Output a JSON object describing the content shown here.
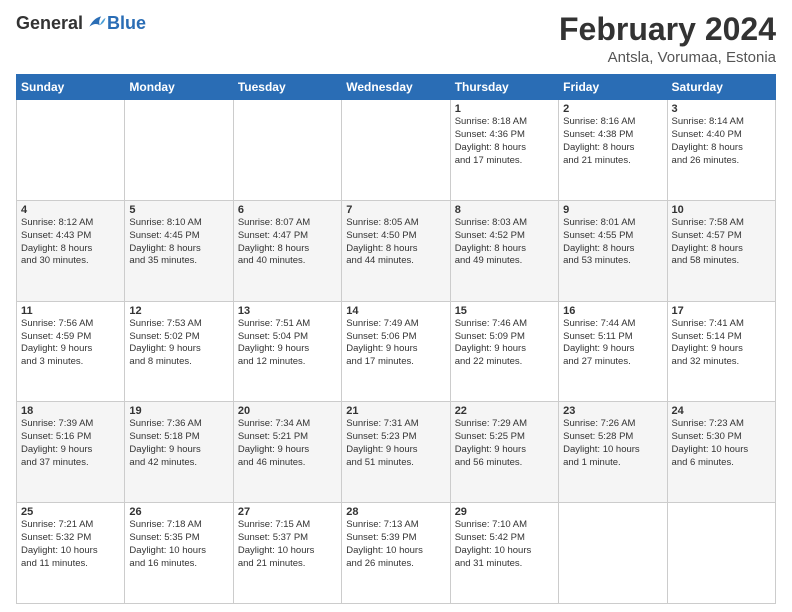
{
  "logo": {
    "general": "General",
    "blue": "Blue"
  },
  "title": "February 2024",
  "location": "Antsla, Vorumaa, Estonia",
  "days_header": [
    "Sunday",
    "Monday",
    "Tuesday",
    "Wednesday",
    "Thursday",
    "Friday",
    "Saturday"
  ],
  "weeks": [
    [
      {
        "day": "",
        "info": ""
      },
      {
        "day": "",
        "info": ""
      },
      {
        "day": "",
        "info": ""
      },
      {
        "day": "",
        "info": ""
      },
      {
        "day": "1",
        "info": "Sunrise: 8:18 AM\nSunset: 4:36 PM\nDaylight: 8 hours\nand 17 minutes."
      },
      {
        "day": "2",
        "info": "Sunrise: 8:16 AM\nSunset: 4:38 PM\nDaylight: 8 hours\nand 21 minutes."
      },
      {
        "day": "3",
        "info": "Sunrise: 8:14 AM\nSunset: 4:40 PM\nDaylight: 8 hours\nand 26 minutes."
      }
    ],
    [
      {
        "day": "4",
        "info": "Sunrise: 8:12 AM\nSunset: 4:43 PM\nDaylight: 8 hours\nand 30 minutes."
      },
      {
        "day": "5",
        "info": "Sunrise: 8:10 AM\nSunset: 4:45 PM\nDaylight: 8 hours\nand 35 minutes."
      },
      {
        "day": "6",
        "info": "Sunrise: 8:07 AM\nSunset: 4:47 PM\nDaylight: 8 hours\nand 40 minutes."
      },
      {
        "day": "7",
        "info": "Sunrise: 8:05 AM\nSunset: 4:50 PM\nDaylight: 8 hours\nand 44 minutes."
      },
      {
        "day": "8",
        "info": "Sunrise: 8:03 AM\nSunset: 4:52 PM\nDaylight: 8 hours\nand 49 minutes."
      },
      {
        "day": "9",
        "info": "Sunrise: 8:01 AM\nSunset: 4:55 PM\nDaylight: 8 hours\nand 53 minutes."
      },
      {
        "day": "10",
        "info": "Sunrise: 7:58 AM\nSunset: 4:57 PM\nDaylight: 8 hours\nand 58 minutes."
      }
    ],
    [
      {
        "day": "11",
        "info": "Sunrise: 7:56 AM\nSunset: 4:59 PM\nDaylight: 9 hours\nand 3 minutes."
      },
      {
        "day": "12",
        "info": "Sunrise: 7:53 AM\nSunset: 5:02 PM\nDaylight: 9 hours\nand 8 minutes."
      },
      {
        "day": "13",
        "info": "Sunrise: 7:51 AM\nSunset: 5:04 PM\nDaylight: 9 hours\nand 12 minutes."
      },
      {
        "day": "14",
        "info": "Sunrise: 7:49 AM\nSunset: 5:06 PM\nDaylight: 9 hours\nand 17 minutes."
      },
      {
        "day": "15",
        "info": "Sunrise: 7:46 AM\nSunset: 5:09 PM\nDaylight: 9 hours\nand 22 minutes."
      },
      {
        "day": "16",
        "info": "Sunrise: 7:44 AM\nSunset: 5:11 PM\nDaylight: 9 hours\nand 27 minutes."
      },
      {
        "day": "17",
        "info": "Sunrise: 7:41 AM\nSunset: 5:14 PM\nDaylight: 9 hours\nand 32 minutes."
      }
    ],
    [
      {
        "day": "18",
        "info": "Sunrise: 7:39 AM\nSunset: 5:16 PM\nDaylight: 9 hours\nand 37 minutes."
      },
      {
        "day": "19",
        "info": "Sunrise: 7:36 AM\nSunset: 5:18 PM\nDaylight: 9 hours\nand 42 minutes."
      },
      {
        "day": "20",
        "info": "Sunrise: 7:34 AM\nSunset: 5:21 PM\nDaylight: 9 hours\nand 46 minutes."
      },
      {
        "day": "21",
        "info": "Sunrise: 7:31 AM\nSunset: 5:23 PM\nDaylight: 9 hours\nand 51 minutes."
      },
      {
        "day": "22",
        "info": "Sunrise: 7:29 AM\nSunset: 5:25 PM\nDaylight: 9 hours\nand 56 minutes."
      },
      {
        "day": "23",
        "info": "Sunrise: 7:26 AM\nSunset: 5:28 PM\nDaylight: 10 hours\nand 1 minute."
      },
      {
        "day": "24",
        "info": "Sunrise: 7:23 AM\nSunset: 5:30 PM\nDaylight: 10 hours\nand 6 minutes."
      }
    ],
    [
      {
        "day": "25",
        "info": "Sunrise: 7:21 AM\nSunset: 5:32 PM\nDaylight: 10 hours\nand 11 minutes."
      },
      {
        "day": "26",
        "info": "Sunrise: 7:18 AM\nSunset: 5:35 PM\nDaylight: 10 hours\nand 16 minutes."
      },
      {
        "day": "27",
        "info": "Sunrise: 7:15 AM\nSunset: 5:37 PM\nDaylight: 10 hours\nand 21 minutes."
      },
      {
        "day": "28",
        "info": "Sunrise: 7:13 AM\nSunset: 5:39 PM\nDaylight: 10 hours\nand 26 minutes."
      },
      {
        "day": "29",
        "info": "Sunrise: 7:10 AM\nSunset: 5:42 PM\nDaylight: 10 hours\nand 31 minutes."
      },
      {
        "day": "",
        "info": ""
      },
      {
        "day": "",
        "info": ""
      }
    ]
  ]
}
